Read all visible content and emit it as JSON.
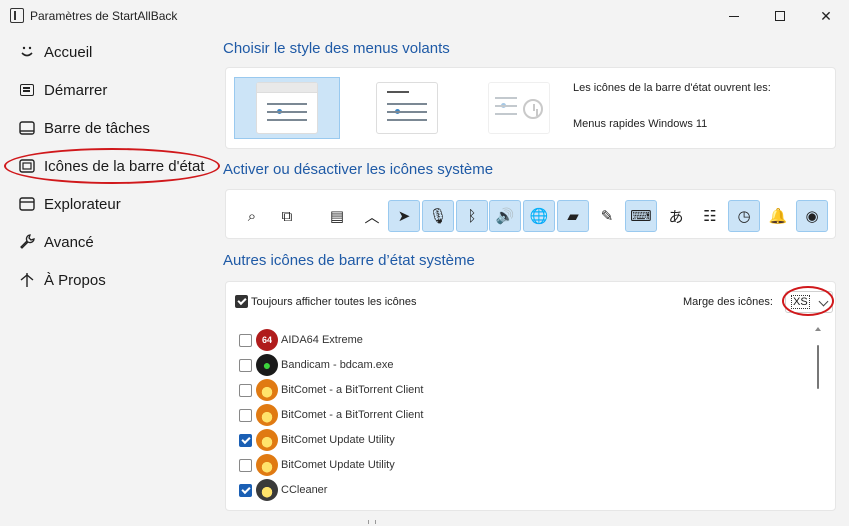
{
  "window": {
    "title": "Paramètres de StartAllBack",
    "minimize": "—",
    "maximize": "□",
    "close": "✕"
  },
  "sidebar": {
    "items": [
      {
        "label": "Accueil",
        "icon": "smiley-icon"
      },
      {
        "label": "Démarrer",
        "icon": "start-menu-icon"
      },
      {
        "label": "Barre de tâches",
        "icon": "taskbar-icon"
      },
      {
        "label": "Icônes de la barre d'état",
        "icon": "tray-icon"
      },
      {
        "label": "Explorateur",
        "icon": "folder-icon"
      },
      {
        "label": "Avancé",
        "icon": "wrench-icon"
      },
      {
        "label": "À Propos",
        "icon": "about-icon"
      }
    ],
    "active_index": 3,
    "highlight_color": "#d0181b"
  },
  "flyout": {
    "title": "Choisir le style des menus volants",
    "open_label": "Les icônes de la barre d'état ouvrent les:",
    "open_value": "Menus rapides Windows 11"
  },
  "system_icons": {
    "title": "Activer ou désactiver les icônes système",
    "icons": [
      {
        "name": "search-icon",
        "glyph": "⌕",
        "on": false
      },
      {
        "name": "task-view-icon",
        "glyph": "⧉",
        "on": false
      },
      {
        "name": "widgets-icon",
        "glyph": "▤",
        "on": false
      },
      {
        "name": "chevron-up-icon",
        "glyph": "︿",
        "on": false
      },
      {
        "name": "location-icon",
        "glyph": "➤",
        "on": true
      },
      {
        "name": "microphone-icon",
        "glyph": "🎙",
        "on": true
      },
      {
        "name": "bluetooth-icon",
        "glyph": "ᛒ",
        "on": true
      },
      {
        "name": "volume-icon",
        "glyph": "🔊",
        "on": true
      },
      {
        "name": "network-icon",
        "glyph": "🌐",
        "on": true
      },
      {
        "name": "battery-icon",
        "glyph": "▰",
        "on": true
      },
      {
        "name": "pen-icon",
        "glyph": "✎",
        "on": false
      },
      {
        "name": "keyboard-icon",
        "glyph": "⌨",
        "on": true
      },
      {
        "name": "language-icon",
        "glyph": "あ",
        "on": false
      },
      {
        "name": "sliders-icon",
        "glyph": "☷",
        "on": false
      },
      {
        "name": "clock-icon",
        "glyph": "◷",
        "on": true
      },
      {
        "name": "bell-icon",
        "glyph": "🔔",
        "on": false
      },
      {
        "name": "eye-icon",
        "glyph": "◉",
        "on": true
      }
    ],
    "accent": "#cce4f7"
  },
  "other_icons": {
    "title": "Autres icônes de barre d’état système",
    "always_show_label": "Toujours afficher toutes les icônes",
    "always_show_checked": true,
    "margin_label": "Marge des icônes:",
    "margin_value": "XS",
    "apps": [
      {
        "name": "AIDA64 Extreme",
        "checked": false,
        "logo": "64",
        "color": "#b01c1c"
      },
      {
        "name": "Bandicam - bdcam.exe",
        "checked": false,
        "logo": "●",
        "color": "#1a1a1a"
      },
      {
        "name": "BitComet - a BitTorrent Client",
        "checked": false,
        "logo": "",
        "color": "#e07a12"
      },
      {
        "name": "BitComet - a BitTorrent Client",
        "checked": false,
        "logo": "",
        "color": "#e07a12"
      },
      {
        "name": "BitComet Update Utility",
        "checked": true,
        "logo": "",
        "color": "#e07a12"
      },
      {
        "name": "BitComet Update Utility",
        "checked": false,
        "logo": "",
        "color": "#e07a12"
      },
      {
        "name": "CCleaner",
        "checked": true,
        "logo": "",
        "color": "#3a3a3a"
      }
    ]
  }
}
